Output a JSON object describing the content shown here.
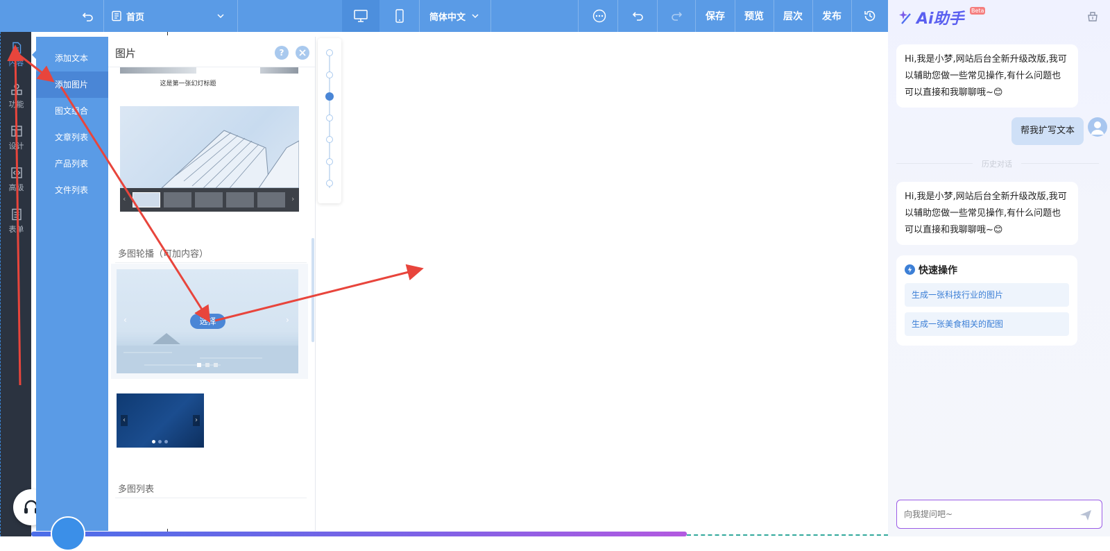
{
  "topbar": {
    "page_label": "首页",
    "language": "简体中文",
    "save": "保存",
    "preview": "预览",
    "layers": "层次",
    "publish": "发布"
  },
  "rail": {
    "items": [
      {
        "label": "内容",
        "icon": "document-icon"
      },
      {
        "label": "功能",
        "icon": "grid-icon"
      },
      {
        "label": "设计",
        "icon": "layout-icon"
      },
      {
        "label": "高级",
        "icon": "code-icon"
      },
      {
        "label": "表单",
        "icon": "form-icon"
      }
    ]
  },
  "categories": [
    "添加文本",
    "添加图片",
    "图文组合",
    "文章列表",
    "产品列表",
    "文件列表"
  ],
  "active_category": "添加图片",
  "component_panel": {
    "title": "图片",
    "slide_caption": "这是第一张幻灯标题",
    "section_carousel": "多图轮播（可加内容）",
    "select_button": "选择",
    "section_list": "多图列表"
  },
  "ai": {
    "title": "Ai助手",
    "badge": "Beta",
    "greeting1": "Hi,我是小梦,网站后台全新升级改版,我可以辅助您做一些常见操作,有什么问题也可以直接和我聊聊哦~😊",
    "user_message": "帮我扩写文本",
    "history_divider": "历史对话",
    "greeting2": "Hi,我是小梦,网站后台全新升级改版,我可以辅助您做一些常见操作,有什么问题也可以直接和我聊聊哦~😊",
    "quick_title": "快速操作",
    "quick_actions": [
      "生成一张科技行业的图片",
      "生成一张美食相关的配图"
    ],
    "input_placeholder": "向我提问吧~"
  },
  "colors": {
    "topbar": "#5a9be6",
    "rail": "#2b3340",
    "arrow": "#e8453c",
    "accent": "#3c7fd6"
  }
}
